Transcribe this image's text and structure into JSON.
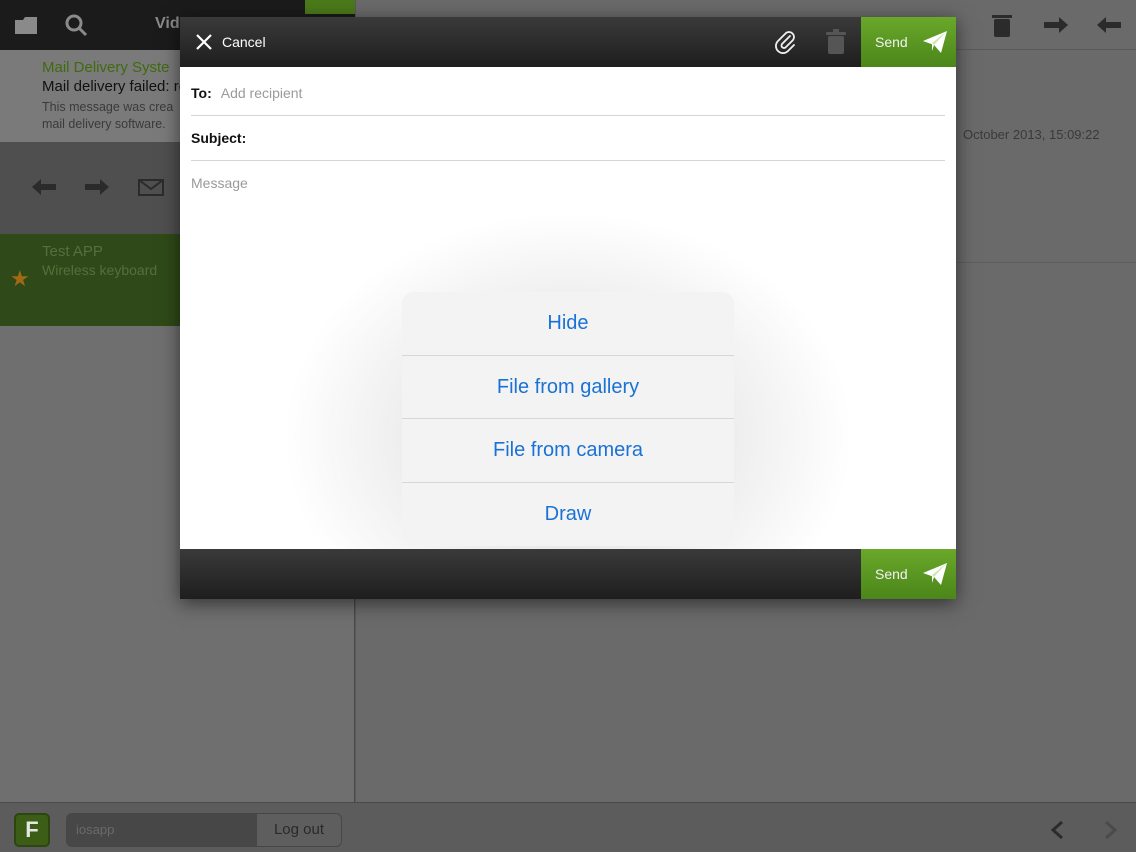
{
  "background": {
    "left_toolbar": {
      "title": "Vid"
    },
    "mail_list": [
      {
        "sender": "Mail Delivery Syste",
        "subject": "Mail delivery failed: re",
        "preview": "This message was crea mail delivery software."
      },
      {
        "sender": "Test APP",
        "preview": "Wireless keyboard",
        "starred": true
      }
    ],
    "message_date": "October 2013, 15:09:22",
    "bottom_bar": {
      "logo": "F",
      "username": "iosapp",
      "logout_label": "Log out"
    }
  },
  "compose": {
    "cancel_label": "Cancel",
    "send_label": "Send",
    "to_label": "To:",
    "to_placeholder": "Add recipient",
    "subject_label": "Subject:",
    "subject_value": "",
    "message_placeholder": "Message"
  },
  "action_sheet": {
    "items": [
      "Hide",
      "File from gallery",
      "File from camera",
      "Draw"
    ]
  },
  "colors": {
    "accent_green": "#5a9a22",
    "action_blue": "#1a72d6",
    "header_dark": "#262626"
  }
}
